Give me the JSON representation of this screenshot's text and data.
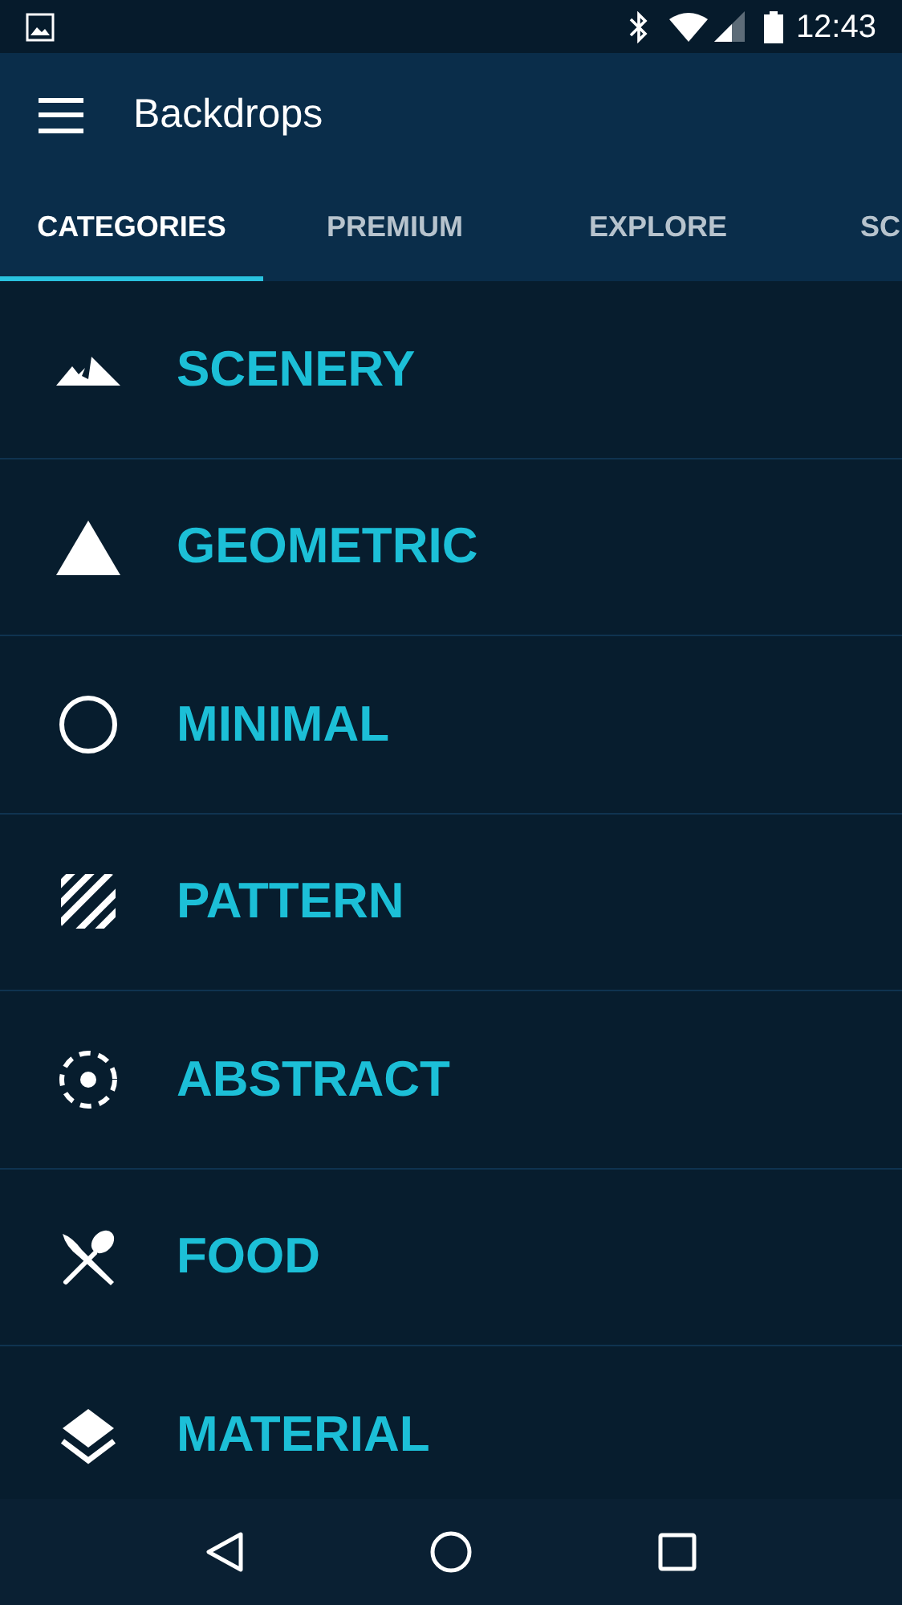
{
  "status_bar": {
    "time": "12:43"
  },
  "app_bar": {
    "title": "Backdrops"
  },
  "tabs": [
    {
      "label": "CATEGORIES",
      "selected": true
    },
    {
      "label": "PREMIUM",
      "selected": false
    },
    {
      "label": "EXPLORE",
      "selected": false
    },
    {
      "label": "SC",
      "selected": false
    }
  ],
  "categories": [
    {
      "label": "SCENERY",
      "kind": "mountains"
    },
    {
      "label": "GEOMETRIC",
      "kind": "triangle"
    },
    {
      "label": "MINIMAL",
      "kind": "circle"
    },
    {
      "label": "PATTERN",
      "kind": "stripes"
    },
    {
      "label": "ABSTRACT",
      "kind": "dashed-circle"
    },
    {
      "label": "FOOD",
      "kind": "utensils"
    },
    {
      "label": "MATERIAL",
      "kind": "layers"
    }
  ]
}
